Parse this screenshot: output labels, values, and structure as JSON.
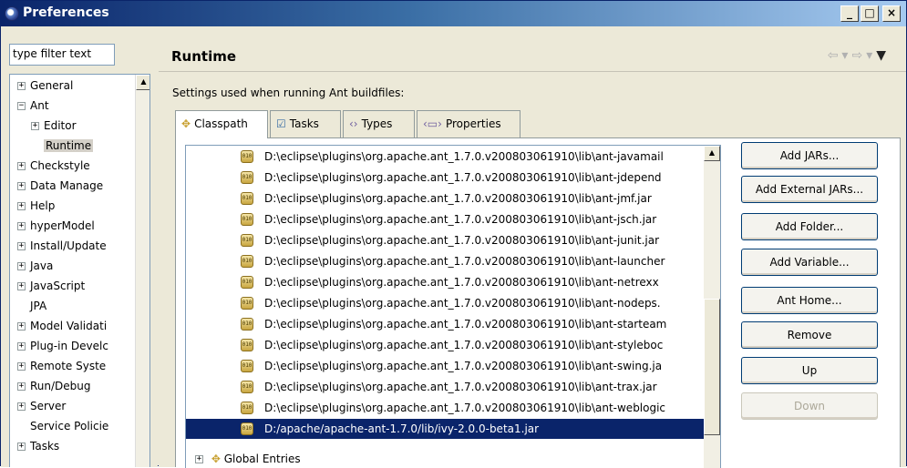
{
  "window": {
    "title": "Preferences",
    "controls": [
      "_",
      "□",
      "×"
    ]
  },
  "left": {
    "filter_placeholder": "type filter text",
    "tree": [
      {
        "label": "General",
        "expander": "+",
        "indent": 0
      },
      {
        "label": "Ant",
        "expander": "−",
        "indent": 0
      },
      {
        "label": "Editor",
        "expander": "+",
        "indent": 1
      },
      {
        "label": "Runtime",
        "expander": "",
        "indent": 1,
        "selected": true
      },
      {
        "label": "Checkstyle",
        "expander": "+",
        "indent": 0
      },
      {
        "label": "Data Manage",
        "expander": "+",
        "indent": 0
      },
      {
        "label": "Help",
        "expander": "+",
        "indent": 0
      },
      {
        "label": "hyperModel",
        "expander": "+",
        "indent": 0
      },
      {
        "label": "Install/Update",
        "expander": "+",
        "indent": 0
      },
      {
        "label": "Java",
        "expander": "+",
        "indent": 0
      },
      {
        "label": "JavaScript",
        "expander": "+",
        "indent": 0
      },
      {
        "label": "JPA",
        "expander": "",
        "indent": 0
      },
      {
        "label": "Model Validati",
        "expander": "+",
        "indent": 0
      },
      {
        "label": "Plug-in Develc",
        "expander": "+",
        "indent": 0
      },
      {
        "label": "Remote Syste",
        "expander": "+",
        "indent": 0
      },
      {
        "label": "Run/Debug",
        "expander": "+",
        "indent": 0
      },
      {
        "label": "Server",
        "expander": "+",
        "indent": 0
      },
      {
        "label": "Service Policie",
        "expander": "",
        "indent": 0
      },
      {
        "label": "Tasks",
        "expander": "+",
        "indent": 0
      }
    ]
  },
  "right": {
    "page_title": "Runtime",
    "nav": {
      "back": "⇦",
      "forward": "⇨",
      "menu": "▼",
      "sep": "▾"
    },
    "description": "Settings used when running Ant buildfiles:",
    "tabs": [
      {
        "label": "Classpath",
        "icon": "✥",
        "active": true
      },
      {
        "label": "Tasks",
        "icon": "☑",
        "active": false
      },
      {
        "label": "Types",
        "icon": "‹›",
        "active": false
      },
      {
        "label": "Properties",
        "icon": "‹▭›",
        "active": false
      }
    ],
    "classpath_entries": [
      "D:\\eclipse\\plugins\\org.apache.ant_1.7.0.v200803061910\\lib\\ant-javamail",
      "D:\\eclipse\\plugins\\org.apache.ant_1.7.0.v200803061910\\lib\\ant-jdepend",
      "D:\\eclipse\\plugins\\org.apache.ant_1.7.0.v200803061910\\lib\\ant-jmf.jar",
      "D:\\eclipse\\plugins\\org.apache.ant_1.7.0.v200803061910\\lib\\ant-jsch.jar",
      "D:\\eclipse\\plugins\\org.apache.ant_1.7.0.v200803061910\\lib\\ant-junit.jar",
      "D:\\eclipse\\plugins\\org.apache.ant_1.7.0.v200803061910\\lib\\ant-launcher",
      "D:\\eclipse\\plugins\\org.apache.ant_1.7.0.v200803061910\\lib\\ant-netrexx",
      "D:\\eclipse\\plugins\\org.apache.ant_1.7.0.v200803061910\\lib\\ant-nodeps.",
      "D:\\eclipse\\plugins\\org.apache.ant_1.7.0.v200803061910\\lib\\ant-starteam",
      "D:\\eclipse\\plugins\\org.apache.ant_1.7.0.v200803061910\\lib\\ant-styleboc",
      "D:\\eclipse\\plugins\\org.apache.ant_1.7.0.v200803061910\\lib\\ant-swing.ja",
      "D:\\eclipse\\plugins\\org.apache.ant_1.7.0.v200803061910\\lib\\ant-trax.jar",
      "D:\\eclipse\\plugins\\org.apache.ant_1.7.0.v200803061910\\lib\\ant-weblogic",
      "D:/apache/apache-ant-1.7.0/lib/ivy-2.0.0-beta1.jar"
    ],
    "selected_entry_index": 13,
    "global_entries_label": "Global Entries",
    "jar_icon_text": "010",
    "buttons": {
      "add_jars": "Add JARs...",
      "add_external_jars": "Add External JARs...",
      "add_folder": "Add Folder...",
      "add_variable": "Add Variable...",
      "ant_home": "Ant Home...",
      "remove": "Remove",
      "up": "Up",
      "down": "Down"
    }
  }
}
